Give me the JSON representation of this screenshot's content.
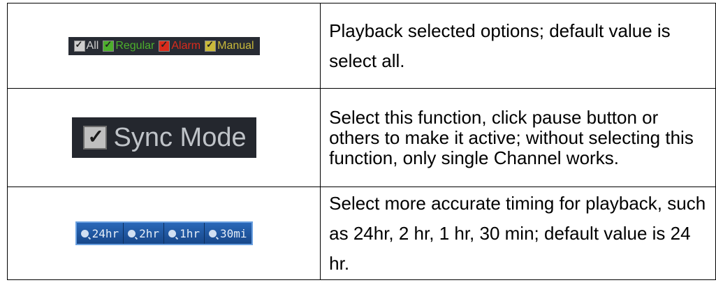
{
  "rows": [
    {
      "filters": [
        {
          "label": "All",
          "checkbox_color": "#cfcfcf",
          "text_color": "#cfcfcf"
        },
        {
          "label": "Regular",
          "checkbox_color": "#4caf2c",
          "text_color": "#4caf2c"
        },
        {
          "label": "Alarm",
          "checkbox_color": "#d92b1c",
          "text_color": "#d92b1c"
        },
        {
          "label": "Manual",
          "checkbox_color": "#c9b93a",
          "text_color": "#c9b93a"
        }
      ],
      "description": "Playback selected options; default value is select all."
    },
    {
      "sync_label": "Sync Mode",
      "description": "Select this function, click pause button or others to make it active; without selecting this function, only single Channel works."
    },
    {
      "zoom_buttons": [
        "24hr",
        "2hr",
        "1hr",
        "30mi"
      ],
      "description": "Select more accurate timing for playback, such as 24hr, 2 hr, 1 hr, 30 min; default value is 24 hr."
    }
  ]
}
